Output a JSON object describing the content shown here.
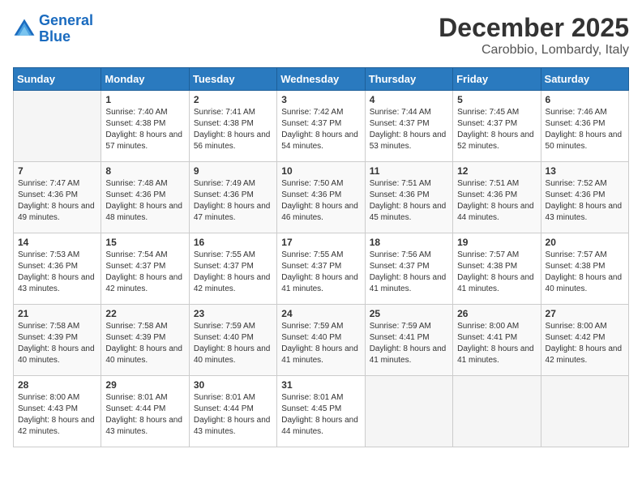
{
  "logo": {
    "line1": "General",
    "line2": "Blue"
  },
  "header": {
    "month": "December 2025",
    "location": "Carobbio, Lombardy, Italy"
  },
  "weekdays": [
    "Sunday",
    "Monday",
    "Tuesday",
    "Wednesday",
    "Thursday",
    "Friday",
    "Saturday"
  ],
  "weeks": [
    [
      {
        "day": "",
        "sunrise": "",
        "sunset": "",
        "daylight": ""
      },
      {
        "day": "1",
        "sunrise": "Sunrise: 7:40 AM",
        "sunset": "Sunset: 4:38 PM",
        "daylight": "Daylight: 8 hours and 57 minutes."
      },
      {
        "day": "2",
        "sunrise": "Sunrise: 7:41 AM",
        "sunset": "Sunset: 4:38 PM",
        "daylight": "Daylight: 8 hours and 56 minutes."
      },
      {
        "day": "3",
        "sunrise": "Sunrise: 7:42 AM",
        "sunset": "Sunset: 4:37 PM",
        "daylight": "Daylight: 8 hours and 54 minutes."
      },
      {
        "day": "4",
        "sunrise": "Sunrise: 7:44 AM",
        "sunset": "Sunset: 4:37 PM",
        "daylight": "Daylight: 8 hours and 53 minutes."
      },
      {
        "day": "5",
        "sunrise": "Sunrise: 7:45 AM",
        "sunset": "Sunset: 4:37 PM",
        "daylight": "Daylight: 8 hours and 52 minutes."
      },
      {
        "day": "6",
        "sunrise": "Sunrise: 7:46 AM",
        "sunset": "Sunset: 4:36 PM",
        "daylight": "Daylight: 8 hours and 50 minutes."
      }
    ],
    [
      {
        "day": "7",
        "sunrise": "Sunrise: 7:47 AM",
        "sunset": "Sunset: 4:36 PM",
        "daylight": "Daylight: 8 hours and 49 minutes."
      },
      {
        "day": "8",
        "sunrise": "Sunrise: 7:48 AM",
        "sunset": "Sunset: 4:36 PM",
        "daylight": "Daylight: 8 hours and 48 minutes."
      },
      {
        "day": "9",
        "sunrise": "Sunrise: 7:49 AM",
        "sunset": "Sunset: 4:36 PM",
        "daylight": "Daylight: 8 hours and 47 minutes."
      },
      {
        "day": "10",
        "sunrise": "Sunrise: 7:50 AM",
        "sunset": "Sunset: 4:36 PM",
        "daylight": "Daylight: 8 hours and 46 minutes."
      },
      {
        "day": "11",
        "sunrise": "Sunrise: 7:51 AM",
        "sunset": "Sunset: 4:36 PM",
        "daylight": "Daylight: 8 hours and 45 minutes."
      },
      {
        "day": "12",
        "sunrise": "Sunrise: 7:51 AM",
        "sunset": "Sunset: 4:36 PM",
        "daylight": "Daylight: 8 hours and 44 minutes."
      },
      {
        "day": "13",
        "sunrise": "Sunrise: 7:52 AM",
        "sunset": "Sunset: 4:36 PM",
        "daylight": "Daylight: 8 hours and 43 minutes."
      }
    ],
    [
      {
        "day": "14",
        "sunrise": "Sunrise: 7:53 AM",
        "sunset": "Sunset: 4:36 PM",
        "daylight": "Daylight: 8 hours and 43 minutes."
      },
      {
        "day": "15",
        "sunrise": "Sunrise: 7:54 AM",
        "sunset": "Sunset: 4:37 PM",
        "daylight": "Daylight: 8 hours and 42 minutes."
      },
      {
        "day": "16",
        "sunrise": "Sunrise: 7:55 AM",
        "sunset": "Sunset: 4:37 PM",
        "daylight": "Daylight: 8 hours and 42 minutes."
      },
      {
        "day": "17",
        "sunrise": "Sunrise: 7:55 AM",
        "sunset": "Sunset: 4:37 PM",
        "daylight": "Daylight: 8 hours and 41 minutes."
      },
      {
        "day": "18",
        "sunrise": "Sunrise: 7:56 AM",
        "sunset": "Sunset: 4:37 PM",
        "daylight": "Daylight: 8 hours and 41 minutes."
      },
      {
        "day": "19",
        "sunrise": "Sunrise: 7:57 AM",
        "sunset": "Sunset: 4:38 PM",
        "daylight": "Daylight: 8 hours and 41 minutes."
      },
      {
        "day": "20",
        "sunrise": "Sunrise: 7:57 AM",
        "sunset": "Sunset: 4:38 PM",
        "daylight": "Daylight: 8 hours and 40 minutes."
      }
    ],
    [
      {
        "day": "21",
        "sunrise": "Sunrise: 7:58 AM",
        "sunset": "Sunset: 4:39 PM",
        "daylight": "Daylight: 8 hours and 40 minutes."
      },
      {
        "day": "22",
        "sunrise": "Sunrise: 7:58 AM",
        "sunset": "Sunset: 4:39 PM",
        "daylight": "Daylight: 8 hours and 40 minutes."
      },
      {
        "day": "23",
        "sunrise": "Sunrise: 7:59 AM",
        "sunset": "Sunset: 4:40 PM",
        "daylight": "Daylight: 8 hours and 40 minutes."
      },
      {
        "day": "24",
        "sunrise": "Sunrise: 7:59 AM",
        "sunset": "Sunset: 4:40 PM",
        "daylight": "Daylight: 8 hours and 41 minutes."
      },
      {
        "day": "25",
        "sunrise": "Sunrise: 7:59 AM",
        "sunset": "Sunset: 4:41 PM",
        "daylight": "Daylight: 8 hours and 41 minutes."
      },
      {
        "day": "26",
        "sunrise": "Sunrise: 8:00 AM",
        "sunset": "Sunset: 4:41 PM",
        "daylight": "Daylight: 8 hours and 41 minutes."
      },
      {
        "day": "27",
        "sunrise": "Sunrise: 8:00 AM",
        "sunset": "Sunset: 4:42 PM",
        "daylight": "Daylight: 8 hours and 42 minutes."
      }
    ],
    [
      {
        "day": "28",
        "sunrise": "Sunrise: 8:00 AM",
        "sunset": "Sunset: 4:43 PM",
        "daylight": "Daylight: 8 hours and 42 minutes."
      },
      {
        "day": "29",
        "sunrise": "Sunrise: 8:01 AM",
        "sunset": "Sunset: 4:44 PM",
        "daylight": "Daylight: 8 hours and 43 minutes."
      },
      {
        "day": "30",
        "sunrise": "Sunrise: 8:01 AM",
        "sunset": "Sunset: 4:44 PM",
        "daylight": "Daylight: 8 hours and 43 minutes."
      },
      {
        "day": "31",
        "sunrise": "Sunrise: 8:01 AM",
        "sunset": "Sunset: 4:45 PM",
        "daylight": "Daylight: 8 hours and 44 minutes."
      },
      {
        "day": "",
        "sunrise": "",
        "sunset": "",
        "daylight": ""
      },
      {
        "day": "",
        "sunrise": "",
        "sunset": "",
        "daylight": ""
      },
      {
        "day": "",
        "sunrise": "",
        "sunset": "",
        "daylight": ""
      }
    ]
  ]
}
